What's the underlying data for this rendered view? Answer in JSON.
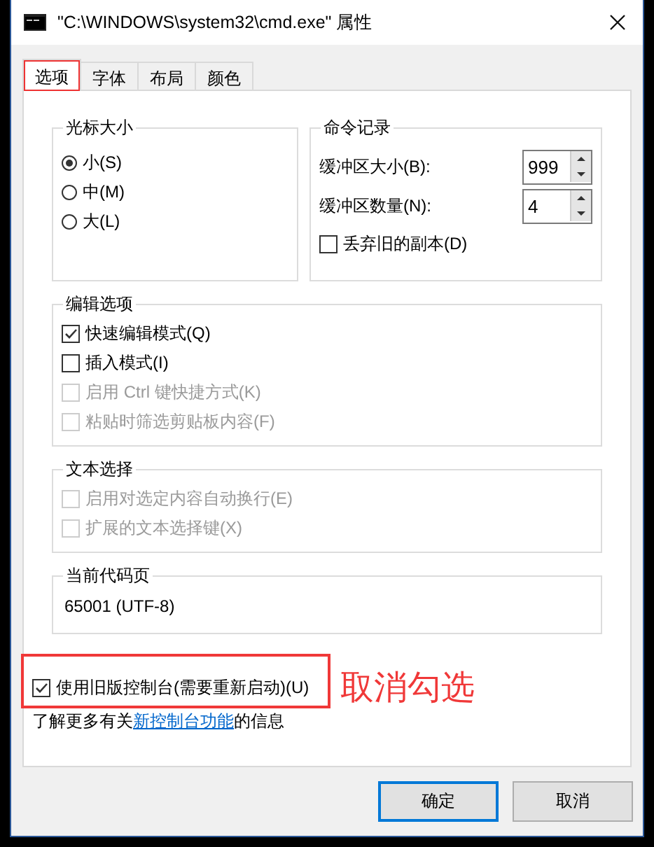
{
  "window": {
    "title": "\"C:\\WINDOWS\\system32\\cmd.exe\" 属性"
  },
  "tabs": [
    {
      "label": "选项",
      "selected": true
    },
    {
      "label": "字体",
      "selected": false
    },
    {
      "label": "布局",
      "selected": false
    },
    {
      "label": "颜色",
      "selected": false
    }
  ],
  "cursor_size": {
    "title": "光标大小",
    "options": [
      {
        "label": "小(S)",
        "selected": true
      },
      {
        "label": "中(M)",
        "selected": false
      },
      {
        "label": "大(L)",
        "selected": false
      }
    ]
  },
  "command_history": {
    "title": "命令记录",
    "fields": [
      {
        "label": "缓冲区大小(B):",
        "value": "999"
      },
      {
        "label": "缓冲区数量(N):",
        "value": "4"
      }
    ],
    "discard": {
      "label": "丢弃旧的副本(D)",
      "checked": false
    }
  },
  "edit_options": {
    "title": "编辑选项",
    "items": [
      {
        "label": "快速编辑模式(Q)",
        "checked": true,
        "disabled": false
      },
      {
        "label": "插入模式(I)",
        "checked": false,
        "disabled": false
      },
      {
        "label": "启用 Ctrl 键快捷方式(K)",
        "checked": false,
        "disabled": true
      },
      {
        "label": "粘贴时筛选剪贴板内容(F)",
        "checked": false,
        "disabled": true
      }
    ]
  },
  "text_selection": {
    "title": "文本选择",
    "items": [
      {
        "label": "启用对选定内容自动换行(E)",
        "checked": false,
        "disabled": true
      },
      {
        "label": "扩展的文本选择键(X)",
        "checked": false,
        "disabled": true
      }
    ]
  },
  "code_page": {
    "title": "当前代码页",
    "value": "65001 (UTF-8)"
  },
  "legacy": {
    "label": "使用旧版控制台(需要重新启动)(U)",
    "checked": true
  },
  "info": {
    "prefix": "了解更多有关",
    "link": "新控制台功能",
    "suffix": "的信息"
  },
  "buttons": [
    {
      "label": "确定",
      "default": true
    },
    {
      "label": "取消",
      "default": false
    }
  ],
  "annotation": {
    "text": "取消勾选"
  }
}
